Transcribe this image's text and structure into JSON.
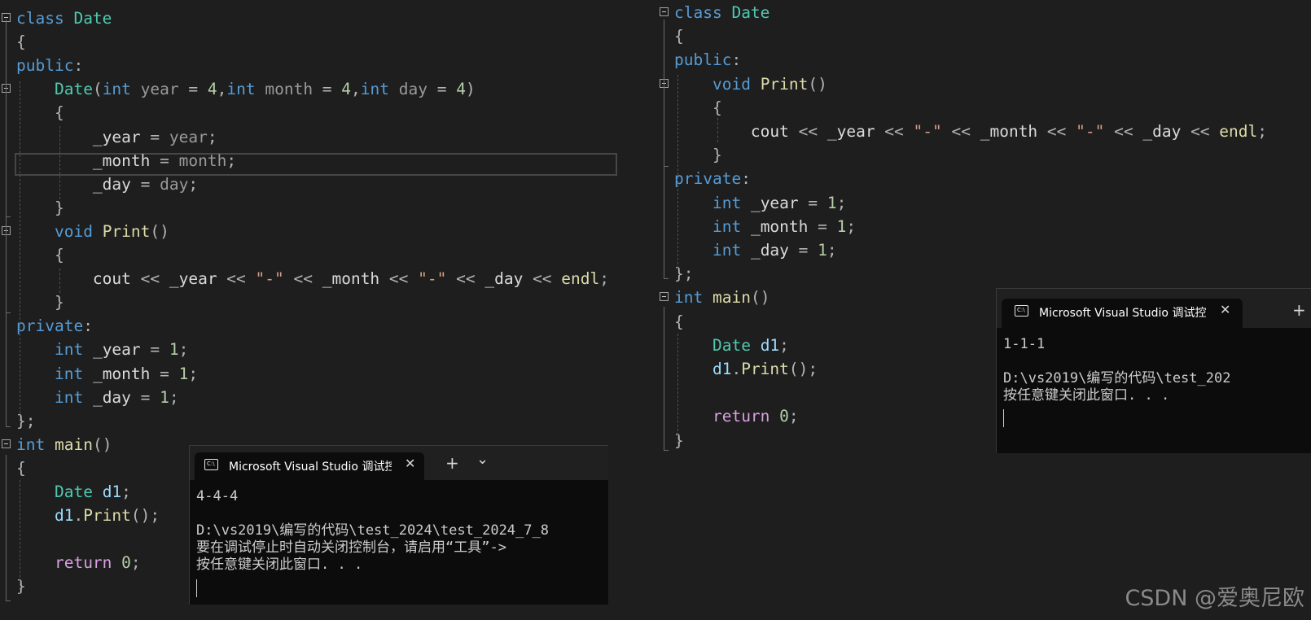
{
  "left_editor": {
    "lines": [
      [
        {
          "t": "class",
          "c": "keyword"
        },
        {
          "t": " "
        },
        {
          "t": "Date",
          "c": "type"
        }
      ],
      [
        {
          "t": "{",
          "c": "punct"
        }
      ],
      [
        {
          "t": "public",
          "c": "keyword"
        },
        {
          "t": ":",
          "c": "punct"
        }
      ],
      [
        {
          "t": "    "
        },
        {
          "t": "Date",
          "c": "type"
        },
        {
          "t": "(",
          "c": "punct"
        },
        {
          "t": "int",
          "c": "keyword"
        },
        {
          "t": " "
        },
        {
          "t": "year",
          "c": "param"
        },
        {
          "t": " = ",
          "c": "op"
        },
        {
          "t": "4",
          "c": "number"
        },
        {
          "t": ",",
          "c": "punct"
        },
        {
          "t": "int",
          "c": "keyword"
        },
        {
          "t": " "
        },
        {
          "t": "month",
          "c": "param"
        },
        {
          "t": " = ",
          "c": "op"
        },
        {
          "t": "4",
          "c": "number"
        },
        {
          "t": ",",
          "c": "punct"
        },
        {
          "t": "int",
          "c": "keyword"
        },
        {
          "t": " "
        },
        {
          "t": "day",
          "c": "param"
        },
        {
          "t": " = ",
          "c": "op"
        },
        {
          "t": "4",
          "c": "number"
        },
        {
          "t": ")",
          "c": "punct"
        }
      ],
      [
        {
          "t": "    "
        },
        {
          "t": "{",
          "c": "punct"
        }
      ],
      [
        {
          "t": "        "
        },
        {
          "t": "_year",
          "c": "member"
        },
        {
          "t": " = ",
          "c": "op"
        },
        {
          "t": "year",
          "c": "param"
        },
        {
          "t": ";",
          "c": "punct"
        }
      ],
      [
        {
          "t": "        "
        },
        {
          "t": "_month",
          "c": "member"
        },
        {
          "t": " = ",
          "c": "op"
        },
        {
          "t": "month",
          "c": "param"
        },
        {
          "t": ";",
          "c": "punct"
        }
      ],
      [
        {
          "t": "        "
        },
        {
          "t": "_day",
          "c": "member"
        },
        {
          "t": " = ",
          "c": "op"
        },
        {
          "t": "day",
          "c": "param"
        },
        {
          "t": ";",
          "c": "punct"
        }
      ],
      [
        {
          "t": "    "
        },
        {
          "t": "}",
          "c": "punct"
        }
      ],
      [
        {
          "t": "    "
        },
        {
          "t": "void",
          "c": "keyword"
        },
        {
          "t": " "
        },
        {
          "t": "Print",
          "c": "func"
        },
        {
          "t": "()",
          "c": "punct"
        }
      ],
      [
        {
          "t": "    "
        },
        {
          "t": "{",
          "c": "punct"
        }
      ],
      [
        {
          "t": "        "
        },
        {
          "t": "cout",
          "c": "ident"
        },
        {
          "t": " << ",
          "c": "op"
        },
        {
          "t": "_year",
          "c": "member"
        },
        {
          "t": " << ",
          "c": "op"
        },
        {
          "t": "\"-\"",
          "c": "string"
        },
        {
          "t": " << ",
          "c": "op"
        },
        {
          "t": "_month",
          "c": "member"
        },
        {
          "t": " << ",
          "c": "op"
        },
        {
          "t": "\"-\"",
          "c": "string"
        },
        {
          "t": " << ",
          "c": "op"
        },
        {
          "t": "_day",
          "c": "member"
        },
        {
          "t": " << ",
          "c": "op"
        },
        {
          "t": "endl",
          "c": "func"
        },
        {
          "t": ";",
          "c": "punct"
        }
      ],
      [
        {
          "t": "    "
        },
        {
          "t": "}",
          "c": "punct"
        }
      ],
      [
        {
          "t": "private",
          "c": "keyword"
        },
        {
          "t": ":",
          "c": "punct"
        }
      ],
      [
        {
          "t": "    "
        },
        {
          "t": "int",
          "c": "keyword"
        },
        {
          "t": " "
        },
        {
          "t": "_year",
          "c": "member"
        },
        {
          "t": " = ",
          "c": "op"
        },
        {
          "t": "1",
          "c": "number"
        },
        {
          "t": ";",
          "c": "punct"
        }
      ],
      [
        {
          "t": "    "
        },
        {
          "t": "int",
          "c": "keyword"
        },
        {
          "t": " "
        },
        {
          "t": "_month",
          "c": "member"
        },
        {
          "t": " = ",
          "c": "op"
        },
        {
          "t": "1",
          "c": "number"
        },
        {
          "t": ";",
          "c": "punct"
        }
      ],
      [
        {
          "t": "    "
        },
        {
          "t": "int",
          "c": "keyword"
        },
        {
          "t": " "
        },
        {
          "t": "_day",
          "c": "member"
        },
        {
          "t": " = ",
          "c": "op"
        },
        {
          "t": "1",
          "c": "number"
        },
        {
          "t": ";",
          "c": "punct"
        }
      ],
      [
        {
          "t": "}",
          "c": "punct"
        },
        {
          "t": ";",
          "c": "punct"
        }
      ],
      [
        {
          "t": "int",
          "c": "keyword"
        },
        {
          "t": " "
        },
        {
          "t": "main",
          "c": "func"
        },
        {
          "t": "()",
          "c": "punct"
        }
      ],
      [
        {
          "t": "{",
          "c": "punct"
        }
      ],
      [
        {
          "t": "    "
        },
        {
          "t": "Date",
          "c": "type"
        },
        {
          "t": " "
        },
        {
          "t": "d1",
          "c": "var"
        },
        {
          "t": ";",
          "c": "punct"
        }
      ],
      [
        {
          "t": "    "
        },
        {
          "t": "d1",
          "c": "var"
        },
        {
          "t": ".",
          "c": "punct"
        },
        {
          "t": "Print",
          "c": "func"
        },
        {
          "t": "();",
          "c": "punct"
        }
      ],
      [
        {
          "t": ""
        }
      ],
      [
        {
          "t": "    "
        },
        {
          "t": "return",
          "c": "control"
        },
        {
          "t": " "
        },
        {
          "t": "0",
          "c": "number"
        },
        {
          "t": ";",
          "c": "punct"
        }
      ],
      [
        {
          "t": "}",
          "c": "punct"
        }
      ]
    ]
  },
  "right_editor": {
    "lines": [
      [
        {
          "t": "class",
          "c": "keyword"
        },
        {
          "t": " "
        },
        {
          "t": "Date",
          "c": "type"
        }
      ],
      [
        {
          "t": "{",
          "c": "punct"
        }
      ],
      [
        {
          "t": "public",
          "c": "keyword"
        },
        {
          "t": ":",
          "c": "punct"
        }
      ],
      [
        {
          "t": "    "
        },
        {
          "t": "void",
          "c": "keyword"
        },
        {
          "t": " "
        },
        {
          "t": "Print",
          "c": "func"
        },
        {
          "t": "()",
          "c": "punct"
        }
      ],
      [
        {
          "t": "    "
        },
        {
          "t": "{",
          "c": "punct"
        }
      ],
      [
        {
          "t": "        "
        },
        {
          "t": "cout",
          "c": "ident"
        },
        {
          "t": " << ",
          "c": "op"
        },
        {
          "t": "_year",
          "c": "member"
        },
        {
          "t": " << ",
          "c": "op"
        },
        {
          "t": "\"-\"",
          "c": "string"
        },
        {
          "t": " << ",
          "c": "op"
        },
        {
          "t": "_month",
          "c": "member"
        },
        {
          "t": " << ",
          "c": "op"
        },
        {
          "t": "\"-\"",
          "c": "string"
        },
        {
          "t": " << ",
          "c": "op"
        },
        {
          "t": "_day",
          "c": "member"
        },
        {
          "t": " << ",
          "c": "op"
        },
        {
          "t": "endl",
          "c": "func"
        },
        {
          "t": ";",
          "c": "punct"
        }
      ],
      [
        {
          "t": "    "
        },
        {
          "t": "}",
          "c": "punct"
        }
      ],
      [
        {
          "t": "private",
          "c": "keyword"
        },
        {
          "t": ":",
          "c": "punct"
        }
      ],
      [
        {
          "t": "    "
        },
        {
          "t": "int",
          "c": "keyword"
        },
        {
          "t": " "
        },
        {
          "t": "_year",
          "c": "member"
        },
        {
          "t": " = ",
          "c": "op"
        },
        {
          "t": "1",
          "c": "number"
        },
        {
          "t": ";",
          "c": "punct"
        }
      ],
      [
        {
          "t": "    "
        },
        {
          "t": "int",
          "c": "keyword"
        },
        {
          "t": " "
        },
        {
          "t": "_month",
          "c": "member"
        },
        {
          "t": " = ",
          "c": "op"
        },
        {
          "t": "1",
          "c": "number"
        },
        {
          "t": ";",
          "c": "punct"
        }
      ],
      [
        {
          "t": "    "
        },
        {
          "t": "int",
          "c": "keyword"
        },
        {
          "t": " "
        },
        {
          "t": "_day",
          "c": "member"
        },
        {
          "t": " = ",
          "c": "op"
        },
        {
          "t": "1",
          "c": "number"
        },
        {
          "t": ";",
          "c": "punct"
        }
      ],
      [
        {
          "t": "}",
          "c": "punct"
        },
        {
          "t": ";",
          "c": "punct"
        }
      ],
      [
        {
          "t": "int",
          "c": "keyword"
        },
        {
          "t": " "
        },
        {
          "t": "main",
          "c": "func"
        },
        {
          "t": "()",
          "c": "punct"
        }
      ],
      [
        {
          "t": "{",
          "c": "punct"
        }
      ],
      [
        {
          "t": "    "
        },
        {
          "t": "Date",
          "c": "type"
        },
        {
          "t": " "
        },
        {
          "t": "d1",
          "c": "var"
        },
        {
          "t": ";",
          "c": "punct"
        }
      ],
      [
        {
          "t": "    "
        },
        {
          "t": "d1",
          "c": "var"
        },
        {
          "t": ".",
          "c": "punct"
        },
        {
          "t": "Print",
          "c": "func"
        },
        {
          "t": "();",
          "c": "punct"
        }
      ],
      [
        {
          "t": ""
        }
      ],
      [
        {
          "t": "    "
        },
        {
          "t": "return",
          "c": "control"
        },
        {
          "t": " "
        },
        {
          "t": "0",
          "c": "number"
        },
        {
          "t": ";",
          "c": "punct"
        }
      ],
      [
        {
          "t": "}",
          "c": "punct"
        }
      ]
    ]
  },
  "console_left": {
    "tab_title": "Microsoft Visual Studio 调试控",
    "close_glyph": "✕",
    "new_tab_glyph": "+",
    "dropdown_glyph": "⌄",
    "icon_glyph": "C:\\",
    "output_lines": [
      "4-4-4",
      "",
      "D:\\vs2019\\编写的代码\\test_2024\\test_2024_7_8",
      "要在调试停止时自动关闭控制台，请启用“工具”->",
      "按任意键关闭此窗口. . ."
    ]
  },
  "console_right": {
    "tab_title": "Microsoft Visual Studio 调试控",
    "close_glyph": "✕",
    "new_tab_glyph": "+",
    "icon_glyph": "C:\\",
    "output_lines": [
      "1-1-1",
      "",
      "D:\\vs2019\\编写的代码\\test_202",
      "按任意键关闭此窗口. . ."
    ]
  },
  "watermark": "CSDN @爱奥尼欧",
  "colors": {
    "editor_bg": "#1e1e1e",
    "keyword": "#569cd6",
    "type": "#4ec9b0",
    "function": "#dcdcaa",
    "number": "#b5cea8",
    "string": "#d69d85",
    "control": "#d8a0df",
    "console_bg": "#0c0c0c"
  }
}
